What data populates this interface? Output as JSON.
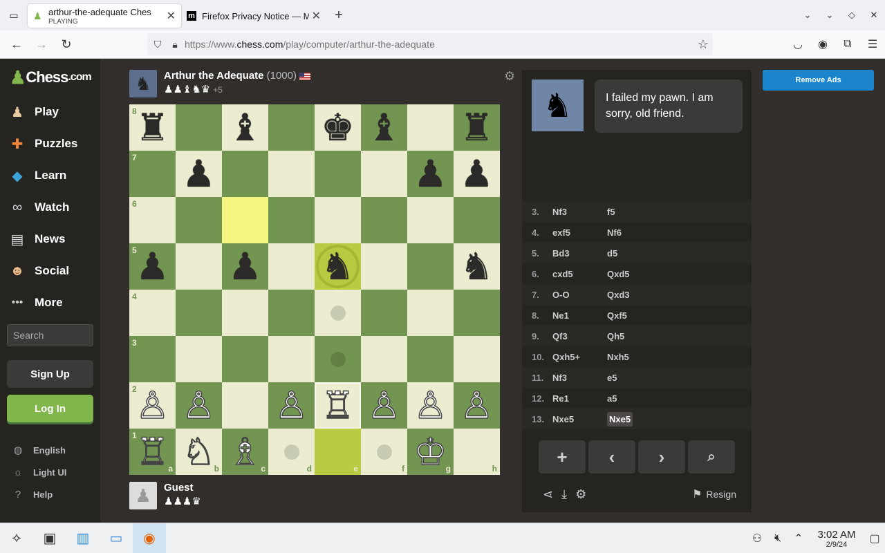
{
  "browser": {
    "tabs": [
      {
        "title": "arthur-the-adequate Ches",
        "subtitle": "PLAYING"
      },
      {
        "title": "Firefox Privacy Notice — M"
      }
    ],
    "url_prefix": "https://www.",
    "url_domain": "chess.com",
    "url_path": "/play/computer/arthur-the-adequate"
  },
  "sidebar": {
    "logo": "Chess",
    "logo_suffix": ".com",
    "items": [
      {
        "label": "Play",
        "icon": "play-pawn-icon"
      },
      {
        "label": "Puzzles",
        "icon": "puzzle-icon"
      },
      {
        "label": "Learn",
        "icon": "learn-cube-icon"
      },
      {
        "label": "Watch",
        "icon": "binoculars-icon"
      },
      {
        "label": "News",
        "icon": "newspaper-icon"
      },
      {
        "label": "Social",
        "icon": "people-icon"
      },
      {
        "label": "More",
        "icon": "more-dots-icon"
      }
    ],
    "search_placeholder": "Search",
    "signup": "Sign Up",
    "login": "Log In",
    "footer": [
      {
        "label": "English",
        "icon": "globe-icon"
      },
      {
        "label": "Light UI",
        "icon": "sun-icon"
      },
      {
        "label": "Help",
        "icon": "help-icon"
      }
    ]
  },
  "opponent": {
    "name": "Arthur the Adequate",
    "rating": "(1000)",
    "captured": "♟♟♝♞♛",
    "advantage": "+5"
  },
  "player": {
    "name": "Guest",
    "captured": "♟♟♟♛"
  },
  "board": {
    "pieces": [
      [
        "♜",
        "",
        "♝",
        "",
        "♚",
        "♝",
        "",
        "♜"
      ],
      [
        "",
        "♟",
        "",
        "",
        "",
        "",
        "♟",
        "♟"
      ],
      [
        "",
        "",
        "",
        "",
        "",
        "",
        "",
        ""
      ],
      [
        "♟",
        "",
        "♟",
        "",
        "♞",
        "",
        "",
        "♞"
      ],
      [
        "",
        "",
        "",
        "",
        "",
        "",
        "",
        ""
      ],
      [
        "",
        "",
        "",
        "",
        "",
        "",
        "",
        ""
      ],
      [
        "♙",
        "♙",
        "",
        "♙",
        "♖",
        "♙",
        "♙",
        "♙"
      ],
      [
        "♖",
        "♘",
        "♗",
        "",
        "",
        "",
        "♔",
        ""
      ]
    ],
    "files": [
      "a",
      "b",
      "c",
      "d",
      "e",
      "f",
      "g",
      "h"
    ],
    "ranks": [
      "8",
      "7",
      "6",
      "5",
      "4",
      "3",
      "2",
      "1"
    ]
  },
  "chat": {
    "message": "I failed my pawn. I am sorry, old friend."
  },
  "moves": [
    {
      "n": "3.",
      "w": "Nf3",
      "b": "f5"
    },
    {
      "n": "4.",
      "w": "exf5",
      "b": "Nf6"
    },
    {
      "n": "5.",
      "w": "Bd3",
      "b": "d5"
    },
    {
      "n": "6.",
      "w": "cxd5",
      "b": "Qxd5"
    },
    {
      "n": "7.",
      "w": "O-O",
      "b": "Qxd3"
    },
    {
      "n": "8.",
      "w": "Ne1",
      "b": "Qxf5"
    },
    {
      "n": "9.",
      "w": "Qf3",
      "b": "Qh5"
    },
    {
      "n": "10.",
      "w": "Qxh5+",
      "b": "Nxh5"
    },
    {
      "n": "11.",
      "w": "Nf3",
      "b": "e5"
    },
    {
      "n": "12.",
      "w": "Re1",
      "b": "a5"
    },
    {
      "n": "13.",
      "w": "Nxe5",
      "b": "Nxe5"
    }
  ],
  "resign": "Resign",
  "remove_ads": "Remove Ads",
  "clock": {
    "time": "3:02 AM",
    "date": "2/9/24"
  },
  "colors": {
    "light_square": "#ebecd0",
    "dark_square": "#739552",
    "brand_green": "#81b64c"
  }
}
